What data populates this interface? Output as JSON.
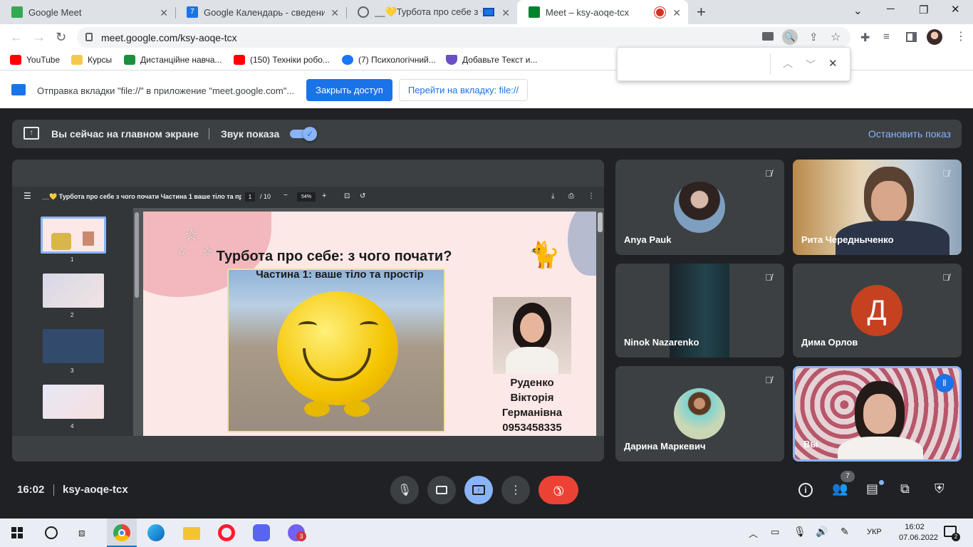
{
  "browser": {
    "tabs": [
      {
        "title": "Google Meet"
      },
      {
        "title": "Google Календарь - сведения о"
      },
      {
        "title": "__💛Турбота про себе з чо"
      },
      {
        "title": "Meet – ksy-aoqe-tcx"
      }
    ],
    "new_tab": "+",
    "url": "meet.google.com/ksy-aoqe-tcx",
    "bookmarks": [
      {
        "label": "YouTube"
      },
      {
        "label": "Курсы"
      },
      {
        "label": "Дистанційне навча..."
      },
      {
        "label": "(150) Техніки робо..."
      },
      {
        "label": "(7) Психологічний..."
      },
      {
        "label": "Добавьте Текст и..."
      }
    ],
    "infobar": {
      "text": "Отправка вкладки \"file://\" в приложение \"meet.google.com\"...",
      "primary_button": "Закрыть доступ",
      "secondary_button": "Перейти на вкладку: file://"
    }
  },
  "meet": {
    "share_banner": {
      "main_screen": "Вы сейчас на главном экране",
      "sound_label": "Звук показа",
      "stop_label": "Остановить показ"
    },
    "pdf": {
      "title": "__💛 Турбота про себе з чого почати Частина 1 ваше тіло та прості...",
      "page_current": "1",
      "page_total": "/ 10",
      "zoom": "54%",
      "thumb_numbers": [
        "1",
        "2",
        "3",
        "4"
      ],
      "slide": {
        "title": "Турбота про себе: з чого почати?",
        "subtitle": "Частина 1: ваше тіло та простір",
        "author_line1": "Руденко",
        "author_line2": "Вікторія",
        "author_line3": "Германівна",
        "phone": "0953458335"
      }
    },
    "participants": [
      {
        "name": "Anya Pauk"
      },
      {
        "name": "Рита Чередныченко"
      },
      {
        "name": "Ninok Nazarenko"
      },
      {
        "name": "Дима Орлов",
        "initial": "Д",
        "color": "#c5411f"
      },
      {
        "name": "Дарина Маркевич"
      },
      {
        "name": "Вы"
      }
    ],
    "time": "16:02",
    "meeting_code": "ksy-aoqe-tcx",
    "people_count": "7"
  },
  "taskbar": {
    "lang": "УКР",
    "time": "16:02",
    "date": "07.06.2022",
    "viber_badge": "3",
    "notif_badge": "2"
  }
}
